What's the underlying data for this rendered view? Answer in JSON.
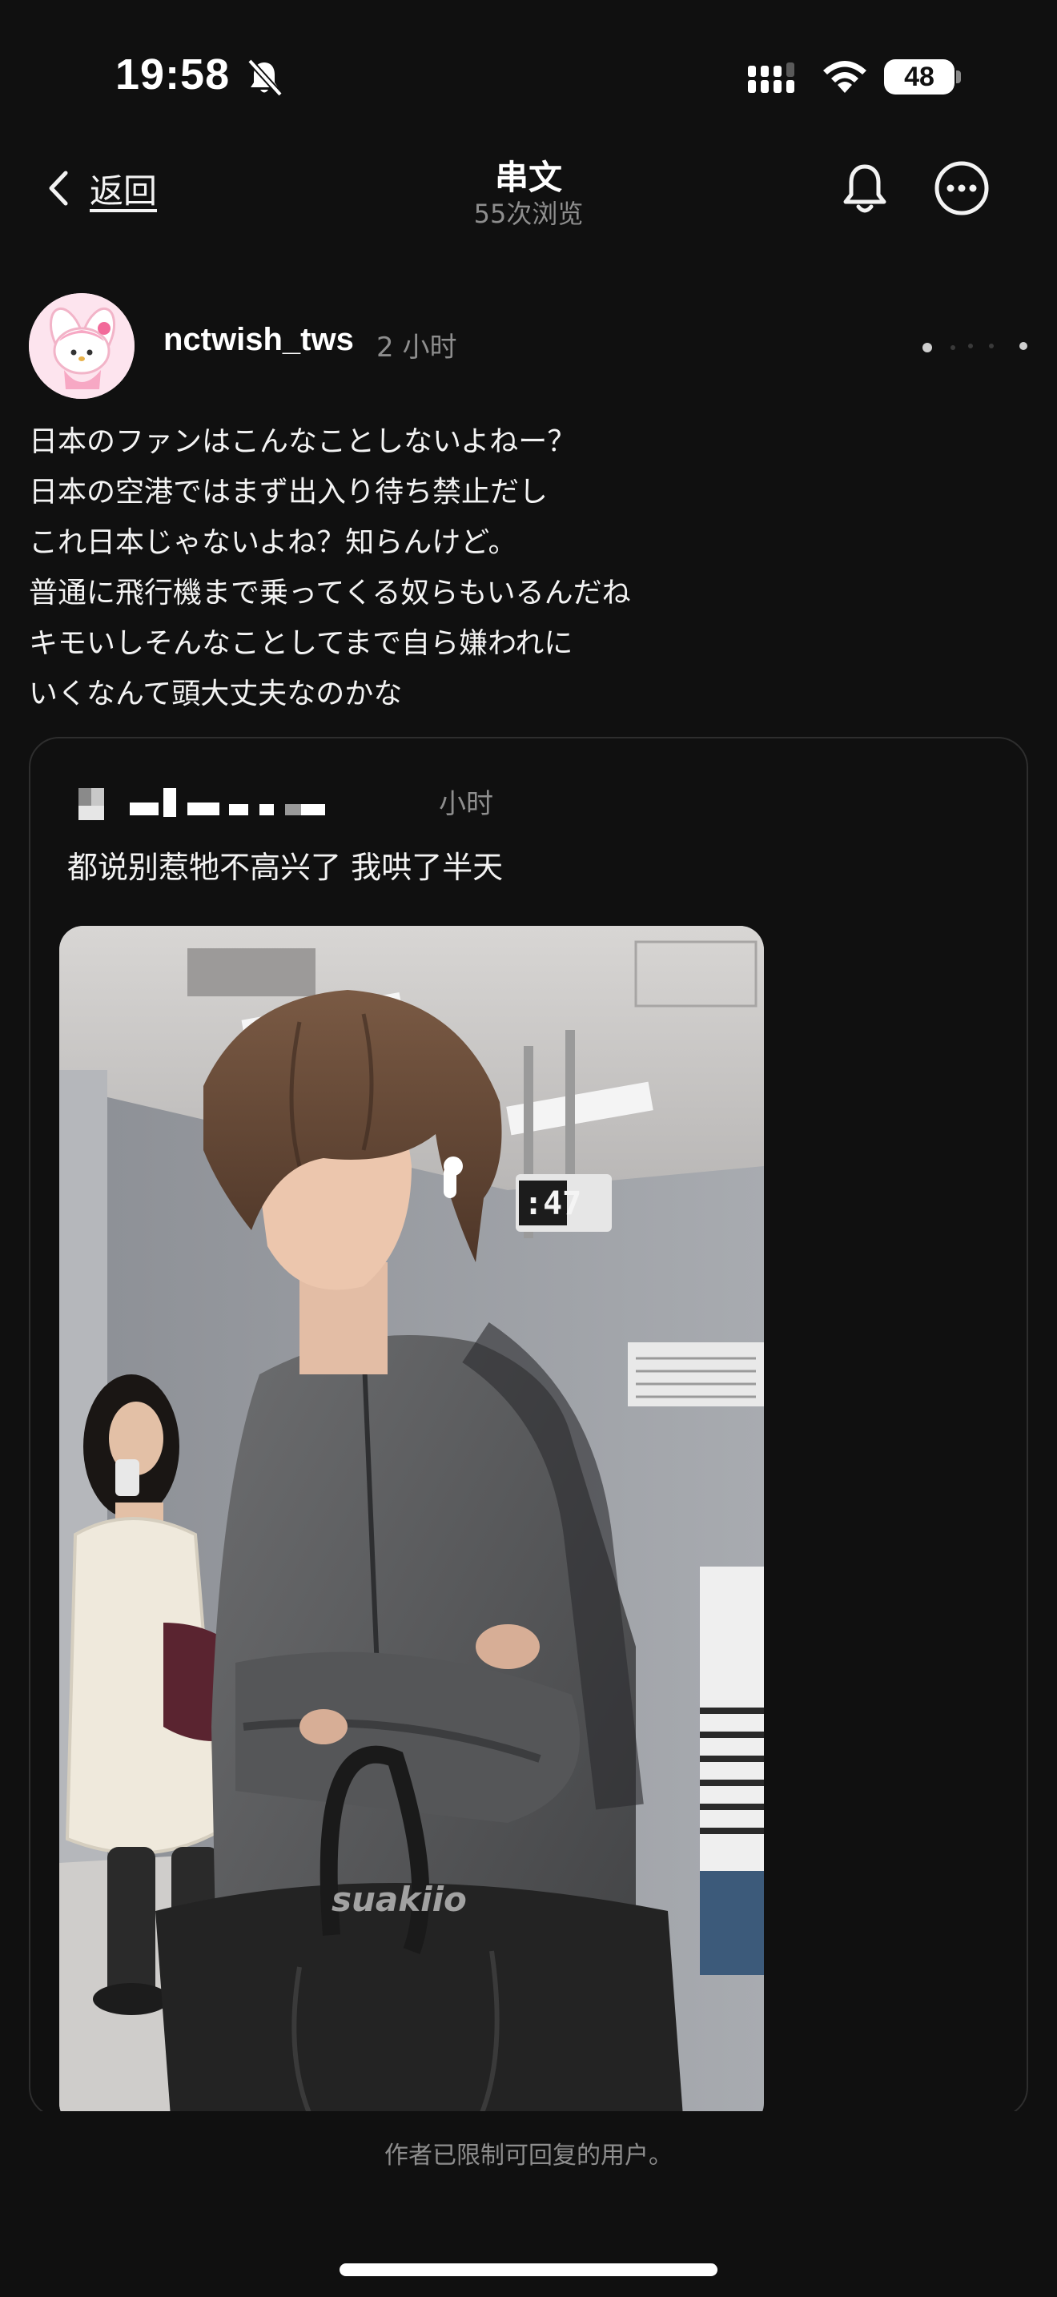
{
  "status_bar": {
    "time": "19:58",
    "battery": "48",
    "icons": [
      "bell-muted-icon",
      "cell-signal-icon",
      "wifi-icon",
      "battery-icon"
    ]
  },
  "header": {
    "back_label": "返回",
    "title": "串文",
    "subtitle": "55次浏览",
    "icons": [
      "chevron-left-icon",
      "bell-icon",
      "more-icon"
    ]
  },
  "post": {
    "username": "nctwish_tws",
    "time": "2 小时",
    "lines": [
      "日本のファンはこんなことしないよねー？",
      "日本の空港ではまず出入り待ち禁止だし",
      "これ日本じゃないよね？知らんけど。",
      "普通に飛行機まで乗ってくる奴らもいるんだね",
      "キモいしそんなことしてまで自ら嫌われに",
      "いくなんて頭大丈夫なのかな"
    ]
  },
  "quoted_post": {
    "time": "小时",
    "text": "都说别惹牠不高兴了 我哄了半天",
    "photo_watermark": "suakiio",
    "photo_clock": ":47"
  },
  "footer": {
    "reply_restriction": "作者已限制可回复的用户。"
  },
  "colors": {
    "background": "#101010",
    "text_primary": "#f3f3f3",
    "text_secondary": "#8e8e8e",
    "card_border": "#2e2e2e"
  }
}
